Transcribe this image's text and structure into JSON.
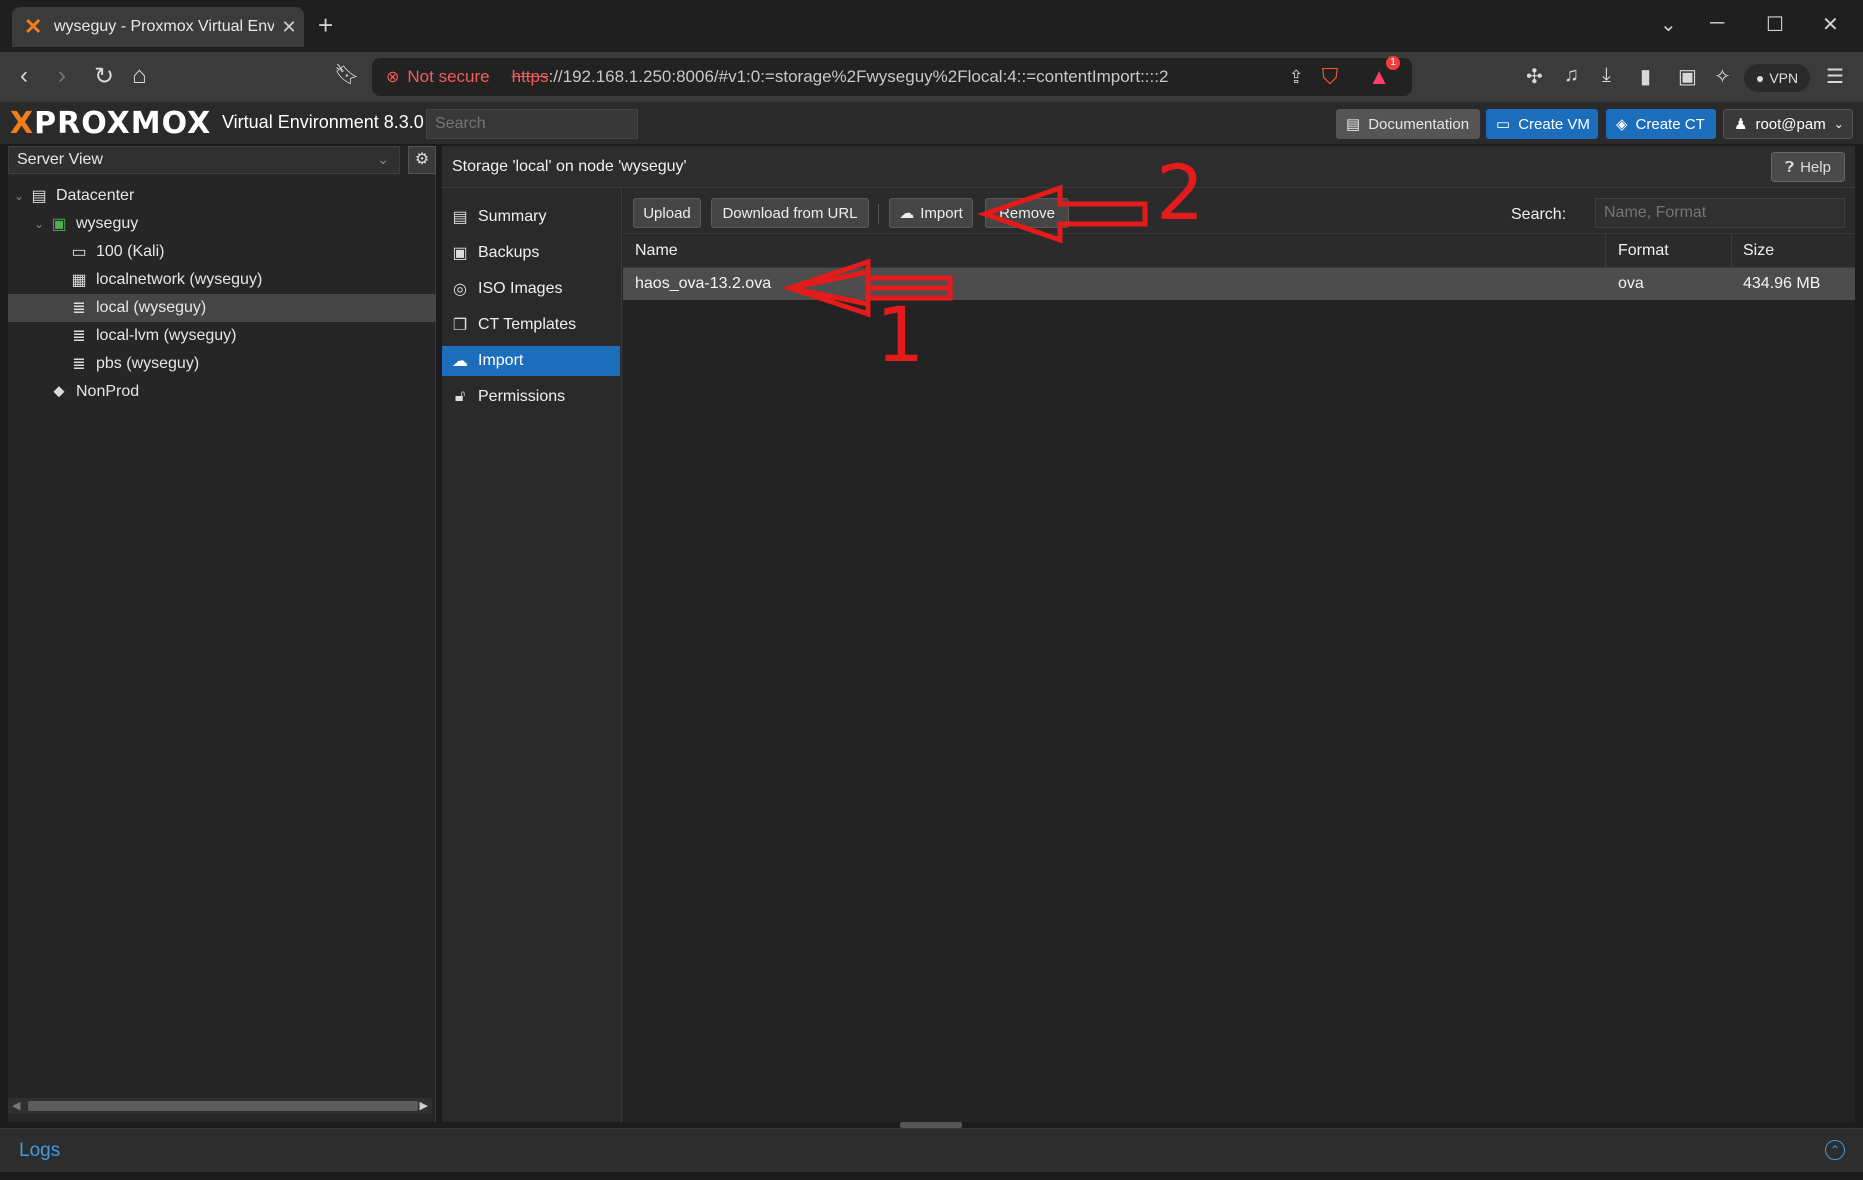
{
  "browser": {
    "tab_title": "wyseguy - Proxmox Virtual Envi",
    "new_tab": "+",
    "security_label": "Not secure",
    "url_scheme": "https",
    "url_rest": "://192.168.1.250:8006/#v1:0:=storage%2Fwyseguy%2Flocal:4::=contentImport::::2",
    "rewards_badge": "1",
    "vpn_label": "VPN"
  },
  "header": {
    "logo_text": "PROXMOX",
    "version": "Virtual Environment 8.3.0",
    "search_placeholder": "Search",
    "documentation": "Documentation",
    "create_vm": "Create VM",
    "create_ct": "Create CT",
    "user": "root@pam"
  },
  "tree": {
    "view_label": "Server View",
    "nodes": [
      {
        "label": "Datacenter",
        "icon": "datacenter-icon"
      },
      {
        "label": "wyseguy",
        "icon": "node-icon"
      },
      {
        "label": "100 (Kali)",
        "icon": "vm-icon"
      },
      {
        "label": "localnetwork (wyseguy)",
        "icon": "network-icon"
      },
      {
        "label": "local (wyseguy)",
        "icon": "storage-icon"
      },
      {
        "label": "local-lvm (wyseguy)",
        "icon": "storage-icon"
      },
      {
        "label": "pbs (wyseguy)",
        "icon": "storage-icon"
      },
      {
        "label": "NonProd",
        "icon": "tag-icon"
      }
    ]
  },
  "panel": {
    "title": "Storage 'local' on node 'wyseguy'",
    "help": "Help",
    "nav": [
      {
        "label": "Summary",
        "icon": "book-icon"
      },
      {
        "label": "Backups",
        "icon": "floppy-icon"
      },
      {
        "label": "ISO Images",
        "icon": "disc-icon"
      },
      {
        "label": "CT Templates",
        "icon": "template-icon"
      },
      {
        "label": "Import",
        "icon": "cloud-upload-icon"
      },
      {
        "label": "Permissions",
        "icon": "unlock-icon"
      }
    ],
    "toolbar": {
      "upload": "Upload",
      "download_url": "Download from URL",
      "import": "Import",
      "remove": "Remove",
      "search_label": "Search:",
      "search_placeholder": "Name, Format"
    },
    "columns": {
      "name": "Name",
      "format": "Format",
      "size": "Size"
    },
    "rows": [
      {
        "name": "haos_ova-13.2.ova",
        "format": "ova",
        "size": "434.96 MB"
      }
    ]
  },
  "logs": {
    "label": "Logs"
  },
  "annotations": {
    "one": "1",
    "two": "2",
    "color": "#e31b1b"
  }
}
